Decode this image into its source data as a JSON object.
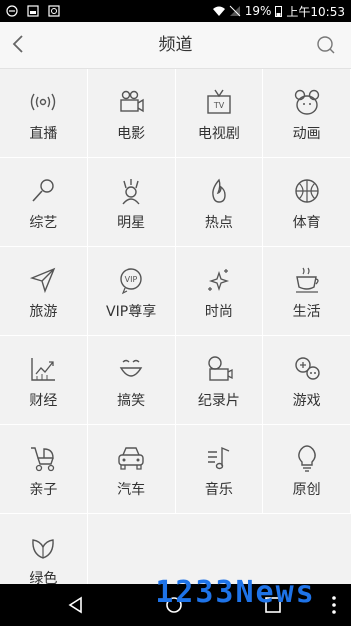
{
  "status_bar": {
    "battery": "19%",
    "time": "上午10:53"
  },
  "header": {
    "title": "频道",
    "back_icon": "back-arrow-icon",
    "search_icon": "search-icon"
  },
  "channels": [
    {
      "label": "直播",
      "icon": "broadcast-icon"
    },
    {
      "label": "电影",
      "icon": "movie-camera-icon"
    },
    {
      "label": "电视剧",
      "icon": "tv-icon"
    },
    {
      "label": "动画",
      "icon": "mouse-ears-icon"
    },
    {
      "label": "综艺",
      "icon": "microphone-icon"
    },
    {
      "label": "明星",
      "icon": "star-person-icon"
    },
    {
      "label": "热点",
      "icon": "flame-icon"
    },
    {
      "label": "体育",
      "icon": "ball-icon"
    },
    {
      "label": "旅游",
      "icon": "paper-plane-icon"
    },
    {
      "label": "VIP尊享",
      "icon": "vip-icon"
    },
    {
      "label": "时尚",
      "icon": "sparkle-icon"
    },
    {
      "label": "生活",
      "icon": "coffee-cup-icon"
    },
    {
      "label": "财经",
      "icon": "finance-chart-icon"
    },
    {
      "label": "搞笑",
      "icon": "smile-icon"
    },
    {
      "label": "纪录片",
      "icon": "documentary-icon"
    },
    {
      "label": "游戏",
      "icon": "gamepad-icon"
    },
    {
      "label": "亲子",
      "icon": "stroller-icon"
    },
    {
      "label": "汽车",
      "icon": "car-icon"
    },
    {
      "label": "音乐",
      "icon": "music-note-icon"
    },
    {
      "label": "原创",
      "icon": "lightbulb-icon"
    },
    {
      "label": "绿色",
      "icon": "leaf-icon"
    }
  ],
  "watermark": "1233News",
  "colors": {
    "icon": "#555555",
    "watermark": "#1e73e8"
  }
}
